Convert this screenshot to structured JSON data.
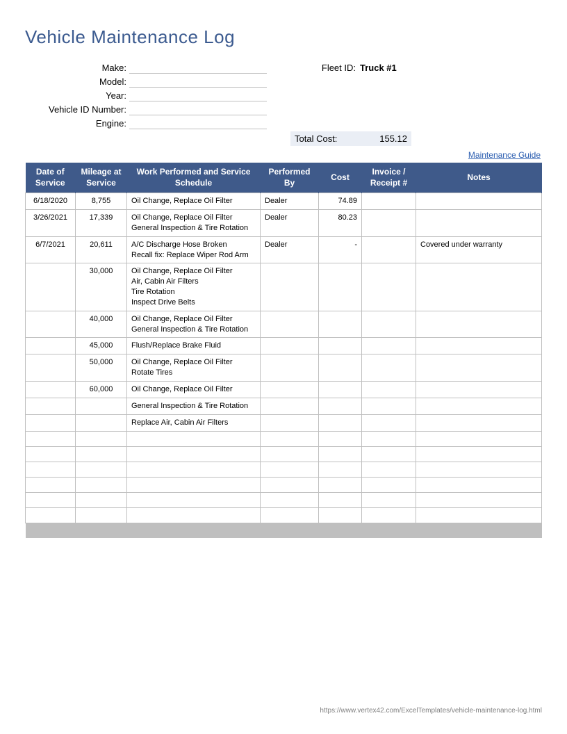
{
  "title": "Vehicle Maintenance Log",
  "fields": {
    "make_label": "Make:",
    "make_value": "",
    "model_label": "Model:",
    "model_value": "",
    "year_label": "Year:",
    "year_value": "",
    "vin_label": "Vehicle ID Number:",
    "vin_value": "",
    "engine_label": "Engine:",
    "engine_value": ""
  },
  "fleet": {
    "label": "Fleet ID:",
    "value": "Truck #1"
  },
  "total": {
    "label": "Total Cost:",
    "value": "155.12"
  },
  "guide_link": "Maintenance Guide",
  "headers": {
    "date": "Date of Service",
    "mileage": "Mileage at Service",
    "work": "Work Performed and Service Schedule",
    "performed": "Performed By",
    "cost": "Cost",
    "invoice": "Invoice / Receipt #",
    "notes": "Notes"
  },
  "rows": [
    {
      "date": "6/18/2020",
      "mileage": "8,755",
      "work": "Oil Change, Replace Oil Filter",
      "performed": "Dealer",
      "cost": "74.89",
      "invoice": "",
      "notes": ""
    },
    {
      "date": "3/26/2021",
      "mileage": "17,339",
      "work": "Oil Change, Replace Oil Filter\nGeneral Inspection & Tire Rotation",
      "performed": "Dealer",
      "cost": "80.23",
      "invoice": "",
      "notes": ""
    },
    {
      "date": "6/7/2021",
      "mileage": "20,611",
      "work": "A/C Discharge Hose Broken\nRecall fix: Replace Wiper Rod Arm",
      "performed": "Dealer",
      "cost": "-",
      "invoice": "",
      "notes": "Covered under warranty"
    },
    {
      "date": "",
      "mileage": "30,000",
      "work": "Oil Change, Replace Oil Filter\nAir, Cabin Air Filters\nTire Rotation\nInspect Drive Belts",
      "performed": "",
      "cost": "",
      "invoice": "",
      "notes": ""
    },
    {
      "date": "",
      "mileage": "40,000",
      "work": "Oil Change, Replace Oil Filter\nGeneral Inspection & Tire Rotation",
      "performed": "",
      "cost": "",
      "invoice": "",
      "notes": ""
    },
    {
      "date": "",
      "mileage": "45,000",
      "work": "Flush/Replace Brake Fluid",
      "performed": "",
      "cost": "",
      "invoice": "",
      "notes": ""
    },
    {
      "date": "",
      "mileage": "50,000",
      "work": "Oil Change, Replace Oil Filter\nRotate Tires",
      "performed": "",
      "cost": "",
      "invoice": "",
      "notes": ""
    },
    {
      "date": "",
      "mileage": "60,000",
      "work": "Oil Change, Replace Oil Filter",
      "performed": "",
      "cost": "",
      "invoice": "",
      "notes": ""
    },
    {
      "date": "",
      "mileage": "",
      "work": "General Inspection & Tire Rotation",
      "performed": "",
      "cost": "",
      "invoice": "",
      "notes": ""
    },
    {
      "date": "",
      "mileage": "",
      "work": "Replace Air, Cabin Air Filters",
      "performed": "",
      "cost": "",
      "invoice": "",
      "notes": ""
    },
    {
      "date": "",
      "mileage": "",
      "work": "",
      "performed": "",
      "cost": "",
      "invoice": "",
      "notes": ""
    },
    {
      "date": "",
      "mileage": "",
      "work": "",
      "performed": "",
      "cost": "",
      "invoice": "",
      "notes": ""
    },
    {
      "date": "",
      "mileage": "",
      "work": "",
      "performed": "",
      "cost": "",
      "invoice": "",
      "notes": ""
    },
    {
      "date": "",
      "mileage": "",
      "work": "",
      "performed": "",
      "cost": "",
      "invoice": "",
      "notes": ""
    },
    {
      "date": "",
      "mileage": "",
      "work": "",
      "performed": "",
      "cost": "",
      "invoice": "",
      "notes": ""
    },
    {
      "date": "",
      "mileage": "",
      "work": "",
      "performed": "",
      "cost": "",
      "invoice": "",
      "notes": ""
    }
  ],
  "footer_url": "https://www.vertex42.com/ExcelTemplates/vehicle-maintenance-log.html"
}
